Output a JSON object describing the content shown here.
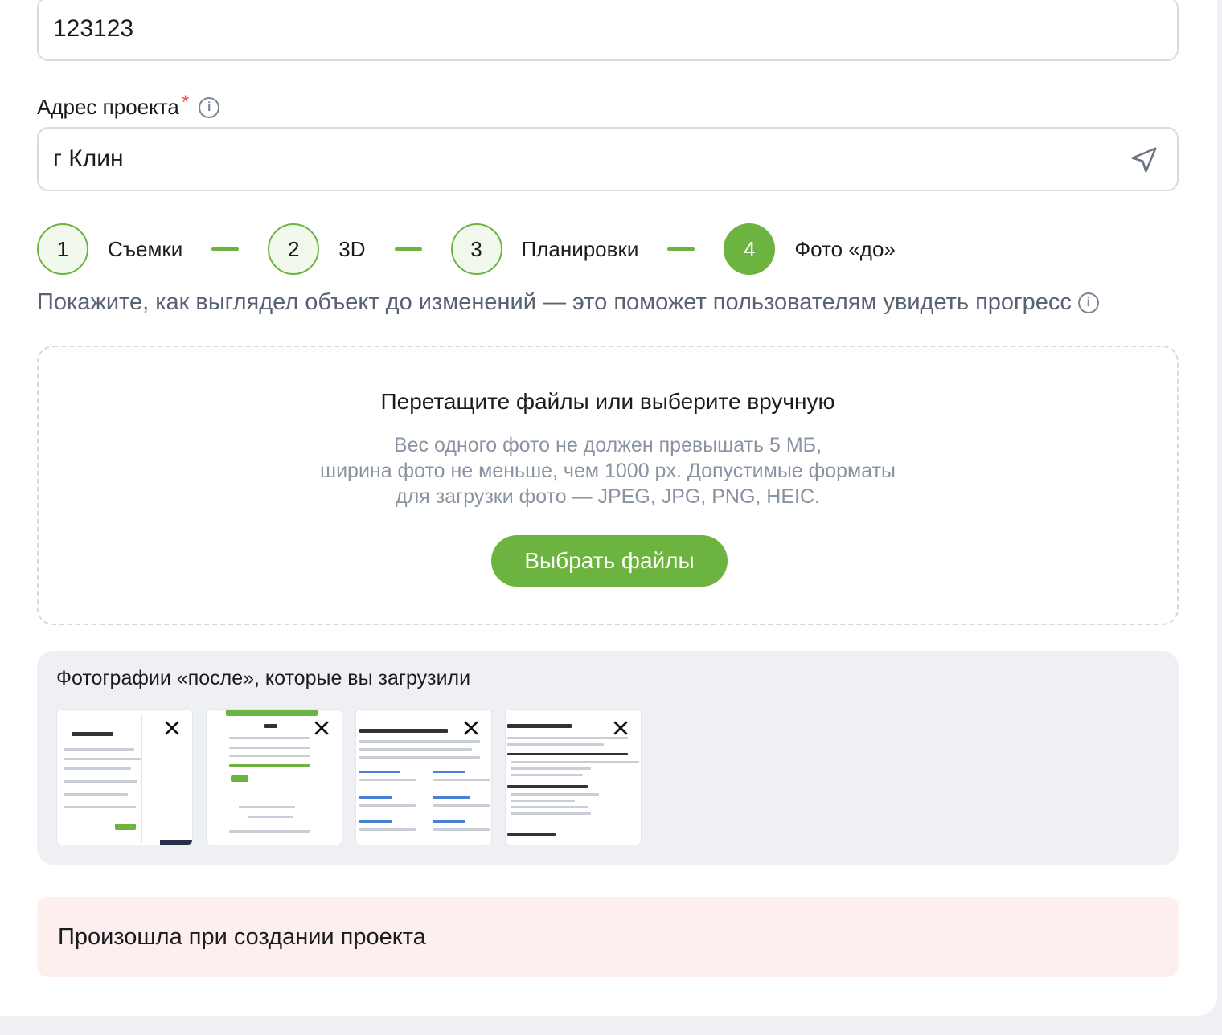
{
  "fields": {
    "project_name_value": "123123",
    "address_label": "Адрес проекта",
    "address_required_mark": "*",
    "address_value": "г Клин"
  },
  "steps": [
    {
      "number": "1",
      "label": "Съемки",
      "active": false
    },
    {
      "number": "2",
      "label": "3D",
      "active": false
    },
    {
      "number": "3",
      "label": "Планировки",
      "active": false
    },
    {
      "number": "4",
      "label": "Фото «до»",
      "active": true
    }
  ],
  "hint": "Покажите, как выглядел объект до изменений — это поможет пользователям увидеть прогресс",
  "dropzone": {
    "title": "Перетащите файлы или выберите вручную",
    "desc_line1": "Вес одного фото не должен превышать 5 МБ,",
    "desc_line2": "ширина фото не меньше, чем 1000 px. Допустимые форматы",
    "desc_line3": "для загрузки фото — JPEG, JPG, PNG, HEIC.",
    "button_label": "Выбрать файлы"
  },
  "uploaded": {
    "title": "Фотографии «после», которые вы загрузили",
    "thumbnails": [
      {
        "icon": "screenshot-profile-form"
      },
      {
        "icon": "screenshot-login-form"
      },
      {
        "icon": "screenshot-experts-page"
      },
      {
        "icon": "screenshot-promotion-page"
      }
    ]
  },
  "error_message": "Произошла при создании проекта",
  "colors": {
    "accent_green": "#6db33f",
    "error_bg": "#fcefee",
    "page_bg": "#eef0f4"
  }
}
